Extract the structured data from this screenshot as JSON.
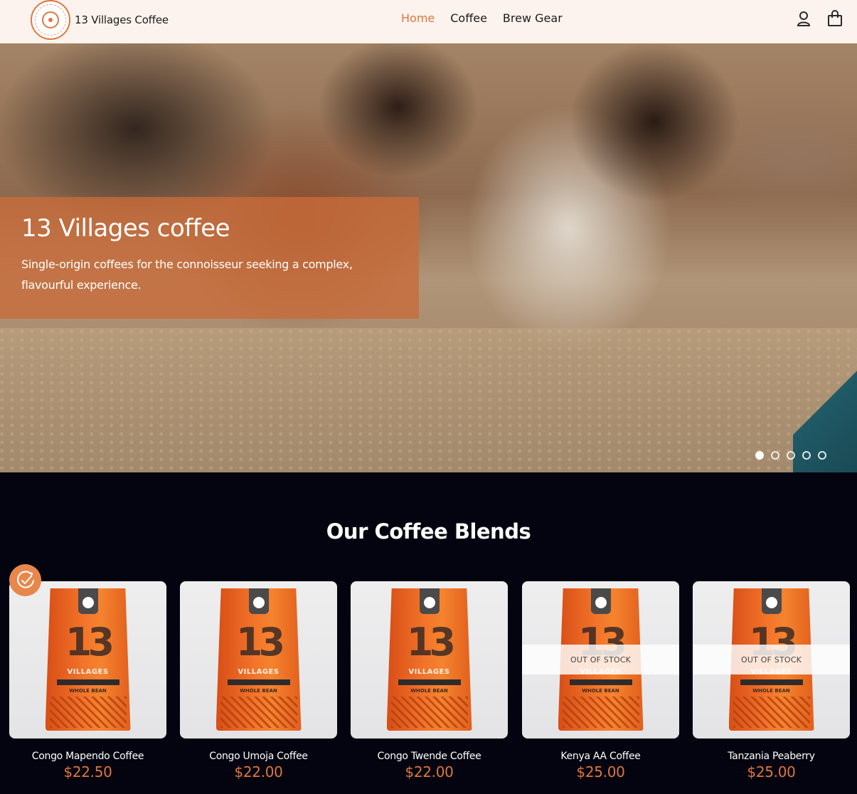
{
  "brand": {
    "name": "13 Villages Coffee",
    "accent": "#e0763e"
  },
  "nav": {
    "items": [
      {
        "label": "Home",
        "active": true
      },
      {
        "label": "Coffee",
        "active": false
      },
      {
        "label": "Brew Gear",
        "active": false
      }
    ]
  },
  "header_icons": [
    "account-icon",
    "shopping-bag-icon"
  ],
  "hero": {
    "title": "13 Villages coffee",
    "subtitle": "Single-origin coffees for the connoisseur seeking a complex, flavourful experience.",
    "slides": 5,
    "active_slide": 1
  },
  "products_section": {
    "title": "Our Coffee Blends",
    "items": [
      {
        "name": "Congo Mapendo Coffee",
        "price": "$22.50",
        "status": ""
      },
      {
        "name": "Congo Umoja Coffee",
        "price": "$22.00",
        "status": ""
      },
      {
        "name": "Congo Twende Coffee",
        "price": "$22.00",
        "status": ""
      },
      {
        "name": "Kenya AA Coffee",
        "price": "$25.00",
        "status": "OUT OF STOCK"
      },
      {
        "name": "Tanzania Peaberry",
        "price": "$25.00",
        "status": "OUT OF STOCK"
      }
    ]
  },
  "floating_badge": {
    "icon": "rewards-check-icon",
    "color": "#e8874c"
  }
}
